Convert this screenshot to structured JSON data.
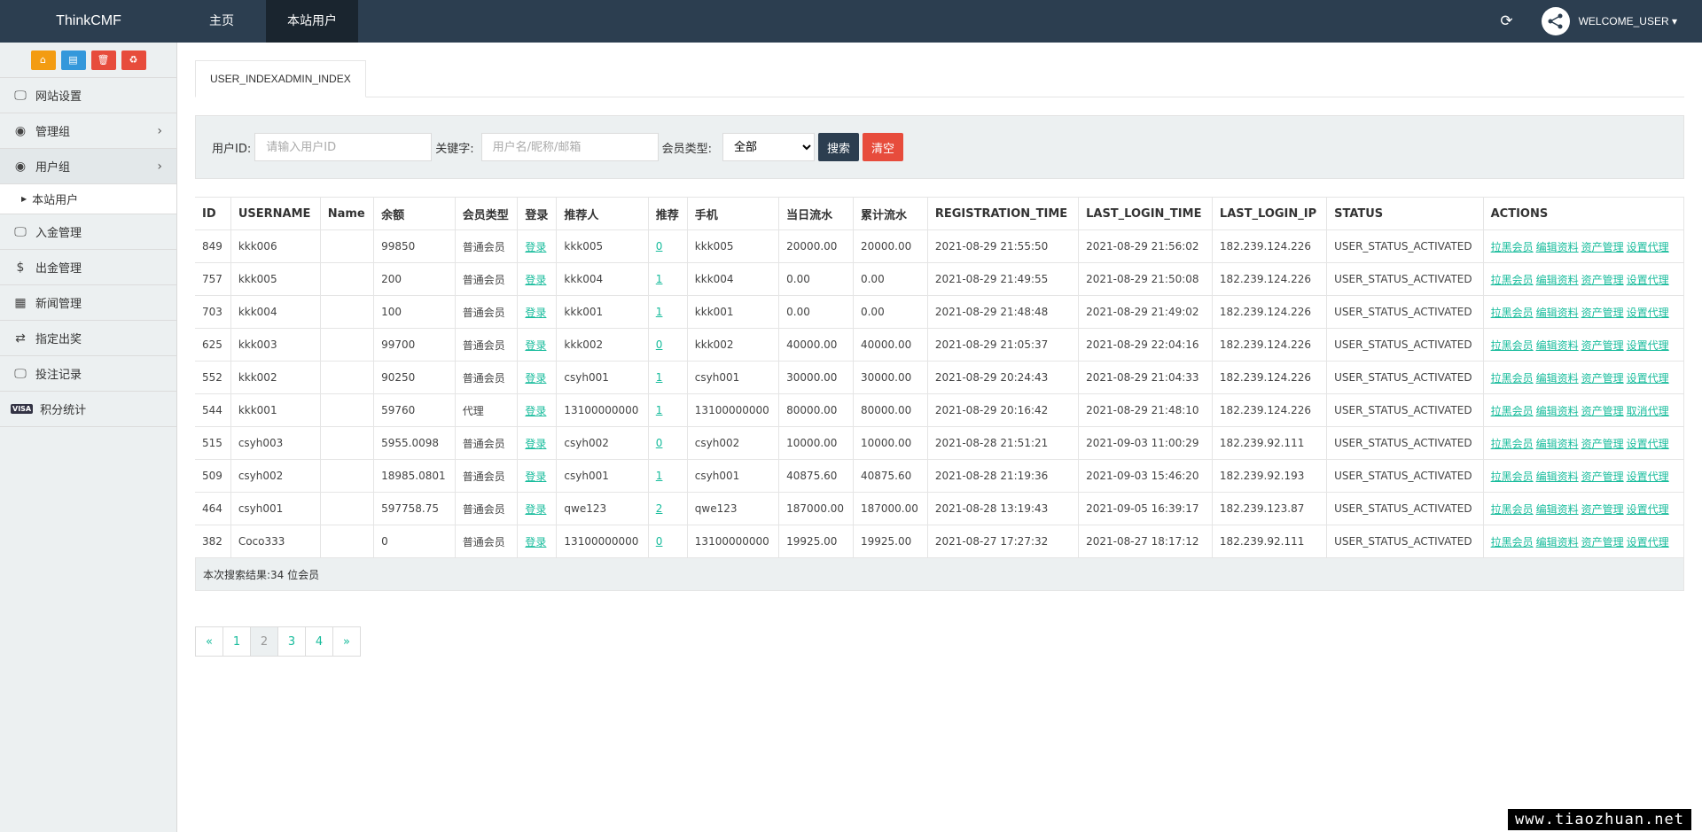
{
  "header": {
    "brand": "ThinkCMF",
    "nav": [
      {
        "label": "主页"
      },
      {
        "label": "本站用户"
      }
    ],
    "refresh_icon": "refresh-icon",
    "user_label": "WELCOME_USER",
    "caret": "▾"
  },
  "sidebar": {
    "shortcut_icons": [
      "home-icon",
      "file-icon",
      "trash-icon",
      "recycle-icon"
    ],
    "items": [
      {
        "label": "网站设置",
        "icon": "monitor-icon"
      },
      {
        "label": "管理组",
        "icon": "user-circle-icon",
        "chevron": "›"
      },
      {
        "label": "用户组",
        "icon": "user-circle-icon",
        "chevron": "›"
      },
      {
        "label": "入金管理",
        "icon": "monitor-icon"
      },
      {
        "label": "出金管理",
        "icon": "dollar-icon"
      },
      {
        "label": "新闻管理",
        "icon": "newspaper-icon"
      },
      {
        "label": "指定出奖",
        "icon": "exchange-icon"
      },
      {
        "label": "投注记录",
        "icon": "monitor-icon"
      },
      {
        "label": "积分统计",
        "icon": "visa-icon"
      }
    ],
    "submenu": [
      {
        "label": "本站用户"
      }
    ]
  },
  "tab": {
    "label": "USER_INDEXADMIN_INDEX"
  },
  "search": {
    "user_id_label": "用户ID:",
    "user_id_placeholder": "请输入用户ID",
    "user_id_value": "",
    "keyword_label": "关键字:",
    "keyword_placeholder": "用户名/昵称/邮箱",
    "keyword_value": "",
    "member_type_label": "会员类型:",
    "member_type_value": "全部",
    "search_button": "搜索",
    "clear_button": "清空"
  },
  "table": {
    "headers": [
      "ID",
      "USERNAME",
      "Name",
      "余额",
      "会员类型",
      "登录",
      "推荐人",
      "推荐",
      "手机",
      "当日流水",
      "累计流水",
      "REGISTRATION_TIME",
      "LAST_LOGIN_TIME",
      "LAST_LOGIN_IP",
      "STATUS",
      "ACTIONS"
    ],
    "rows": [
      {
        "id": "849",
        "username": "kkk006",
        "name": "",
        "balance": "99850",
        "type": "普通会员",
        "login": "登录",
        "referrer": "kkk005",
        "refs": "0",
        "phone": "kkk005",
        "daily": "20000.00",
        "total": "20000.00",
        "reg": "2021-08-29 21:55:50",
        "last": "2021-08-29 21:56:02",
        "ip": "182.239.124.226",
        "status": "USER_STATUS_ACTIVATED",
        "actions": [
          "拉黑会员",
          "编辑资料",
          "资产管理",
          "设置代理"
        ]
      },
      {
        "id": "757",
        "username": "kkk005",
        "name": "",
        "balance": "200",
        "type": "普通会员",
        "login": "登录",
        "referrer": "kkk004",
        "refs": "1",
        "phone": "kkk004",
        "daily": "0.00",
        "total": "0.00",
        "reg": "2021-08-29 21:49:55",
        "last": "2021-08-29 21:50:08",
        "ip": "182.239.124.226",
        "status": "USER_STATUS_ACTIVATED",
        "actions": [
          "拉黑会员",
          "编辑资料",
          "资产管理",
          "设置代理"
        ]
      },
      {
        "id": "703",
        "username": "kkk004",
        "name": "",
        "balance": "100",
        "type": "普通会员",
        "login": "登录",
        "referrer": "kkk001",
        "refs": "1",
        "phone": "kkk001",
        "daily": "0.00",
        "total": "0.00",
        "reg": "2021-08-29 21:48:48",
        "last": "2021-08-29 21:49:02",
        "ip": "182.239.124.226",
        "status": "USER_STATUS_ACTIVATED",
        "actions": [
          "拉黑会员",
          "编辑资料",
          "资产管理",
          "设置代理"
        ]
      },
      {
        "id": "625",
        "username": "kkk003",
        "name": "",
        "balance": "99700",
        "type": "普通会员",
        "login": "登录",
        "referrer": "kkk002",
        "refs": "0",
        "phone": "kkk002",
        "daily": "40000.00",
        "total": "40000.00",
        "reg": "2021-08-29 21:05:37",
        "last": "2021-08-29 22:04:16",
        "ip": "182.239.124.226",
        "status": "USER_STATUS_ACTIVATED",
        "actions": [
          "拉黑会员",
          "编辑资料",
          "资产管理",
          "设置代理"
        ]
      },
      {
        "id": "552",
        "username": "kkk002",
        "name": "",
        "balance": "90250",
        "type": "普通会员",
        "login": "登录",
        "referrer": "csyh001",
        "refs": "1",
        "phone": "csyh001",
        "daily": "30000.00",
        "total": "30000.00",
        "reg": "2021-08-29 20:24:43",
        "last": "2021-08-29 21:04:33",
        "ip": "182.239.124.226",
        "status": "USER_STATUS_ACTIVATED",
        "actions": [
          "拉黑会员",
          "编辑资料",
          "资产管理",
          "设置代理"
        ]
      },
      {
        "id": "544",
        "username": "kkk001",
        "name": "",
        "balance": "59760",
        "type": "代理",
        "login": "登录",
        "referrer": "13100000000",
        "refs": "1",
        "phone": "13100000000",
        "daily": "80000.00",
        "total": "80000.00",
        "reg": "2021-08-29 20:16:42",
        "last": "2021-08-29 21:48:10",
        "ip": "182.239.124.226",
        "status": "USER_STATUS_ACTIVATED",
        "actions": [
          "拉黑会员",
          "编辑资料",
          "资产管理",
          "取消代理"
        ]
      },
      {
        "id": "515",
        "username": "csyh003",
        "name": "",
        "balance": "5955.0098",
        "type": "普通会员",
        "login": "登录",
        "referrer": "csyh002",
        "refs": "0",
        "phone": "csyh002",
        "daily": "10000.00",
        "total": "10000.00",
        "reg": "2021-08-28 21:51:21",
        "last": "2021-09-03 11:00:29",
        "ip": "182.239.92.111",
        "status": "USER_STATUS_ACTIVATED",
        "actions": [
          "拉黑会员",
          "编辑资料",
          "资产管理",
          "设置代理"
        ]
      },
      {
        "id": "509",
        "username": "csyh002",
        "name": "",
        "balance": "18985.0801",
        "type": "普通会员",
        "login": "登录",
        "referrer": "csyh001",
        "refs": "1",
        "phone": "csyh001",
        "daily": "40875.60",
        "total": "40875.60",
        "reg": "2021-08-28 21:19:36",
        "last": "2021-09-03 15:46:20",
        "ip": "182.239.92.193",
        "status": "USER_STATUS_ACTIVATED",
        "actions": [
          "拉黑会员",
          "编辑资料",
          "资产管理",
          "设置代理"
        ]
      },
      {
        "id": "464",
        "username": "csyh001",
        "name": "",
        "balance": "597758.75",
        "type": "普通会员",
        "login": "登录",
        "referrer": "qwe123",
        "refs": "2",
        "phone": "qwe123",
        "daily": "187000.00",
        "total": "187000.00",
        "reg": "2021-08-28 13:19:43",
        "last": "2021-09-05 16:39:17",
        "ip": "182.239.123.87",
        "status": "USER_STATUS_ACTIVATED",
        "actions": [
          "拉黑会员",
          "编辑资料",
          "资产管理",
          "设置代理"
        ]
      },
      {
        "id": "382",
        "username": "Coco333",
        "name": "",
        "balance": "0",
        "type": "普通会员",
        "login": "登录",
        "referrer": "13100000000",
        "refs": "0",
        "phone": "13100000000",
        "daily": "19925.00",
        "total": "19925.00",
        "reg": "2021-08-27 17:27:32",
        "last": "2021-08-27 18:17:12",
        "ip": "182.239.92.111",
        "status": "USER_STATUS_ACTIVATED",
        "actions": [
          "拉黑会员",
          "编辑资料",
          "资产管理",
          "设置代理"
        ]
      }
    ],
    "summary": "本次搜索结果:34 位会员"
  },
  "pagination": {
    "items": [
      "«",
      "1",
      "2",
      "3",
      "4",
      "»"
    ],
    "active": "2"
  },
  "watermark": "www.tiaozhuan.net",
  "colors": {
    "header_bg": "#2c3e50",
    "link": "#18bc9c",
    "danger": "#e74c3c",
    "warning": "#f39c12",
    "info": "#3498db",
    "panel": "#ecf0f1"
  }
}
